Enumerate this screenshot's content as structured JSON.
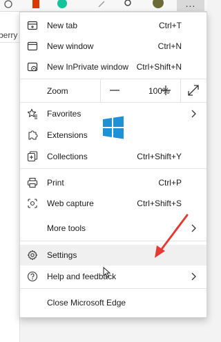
{
  "toolbar": {
    "more_label": "..."
  },
  "page": {
    "sliver_text": "berry"
  },
  "menu": {
    "new_tab": {
      "label": "New tab",
      "shortcut": "Ctrl+T"
    },
    "new_window": {
      "label": "New window",
      "shortcut": "Ctrl+N"
    },
    "new_inprivate": {
      "label": "New InPrivate window",
      "shortcut": "Ctrl+Shift+N"
    },
    "zoom": {
      "label": "Zoom",
      "value": "100%"
    },
    "favorites": {
      "label": "Favorites"
    },
    "extensions": {
      "label": "Extensions"
    },
    "collections": {
      "label": "Collections",
      "shortcut": "Ctrl+Shift+Y"
    },
    "print": {
      "label": "Print",
      "shortcut": "Ctrl+P"
    },
    "web_capture": {
      "label": "Web capture",
      "shortcut": "Ctrl+Shift+S"
    },
    "more_tools": {
      "label": "More tools"
    },
    "settings": {
      "label": "Settings"
    },
    "help": {
      "label": "Help and feedback"
    },
    "close": {
      "label": "Close Microsoft Edge"
    }
  },
  "colors": {
    "arrow": "#e53935",
    "windows_logo": "#1e90d6",
    "hover": "#f0f0f0"
  }
}
